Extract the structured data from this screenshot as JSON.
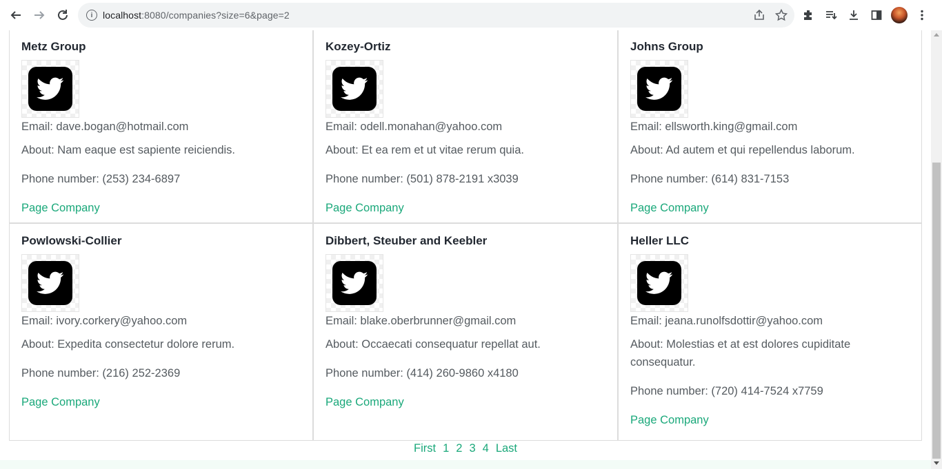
{
  "browser": {
    "url_host": "localhost",
    "url_rest": ":8080/companies?size=6&page=2"
  },
  "companies": [
    {
      "name": "Metz Group",
      "email": "Email: dave.bogan@hotmail.com",
      "about": "About: Nam eaque est sapiente reiciendis.",
      "phone": "Phone number: (253) 234-6897",
      "link": "Page Company"
    },
    {
      "name": "Kozey-Ortiz",
      "email": "Email: odell.monahan@yahoo.com",
      "about": "About: Et ea rem et ut vitae rerum quia.",
      "phone": "Phone number: (501) 878-2191 x3039",
      "link": "Page Company"
    },
    {
      "name": "Johns Group",
      "email": "Email: ellsworth.king@gmail.com",
      "about": "About: Ad autem et qui repellendus laborum.",
      "phone": "Phone number: (614) 831-7153",
      "link": "Page Company"
    },
    {
      "name": "Powlowski-Collier",
      "email": "Email: ivory.corkery@yahoo.com",
      "about": "About: Expedita consectetur dolore rerum.",
      "phone": "Phone number: (216) 252-2369",
      "link": "Page Company"
    },
    {
      "name": "Dibbert, Steuber and Keebler",
      "email": "Email: blake.oberbrunner@gmail.com",
      "about": "About: Occaecati consequatur repellat aut.",
      "phone": "Phone number: (414) 260-9860 x4180",
      "link": "Page Company"
    },
    {
      "name": "Heller LLC",
      "email": "Email: jeana.runolfsdottir@yahoo.com",
      "about": "About: Molestias et at est dolores cupiditate consequatur.",
      "phone": "Phone number: (720) 414-7524 x7759",
      "link": "Page Company"
    }
  ],
  "pagination": {
    "first": "First",
    "pages": [
      "1",
      "2",
      "3",
      "4"
    ],
    "last": "Last"
  },
  "colors": {
    "accent": "#1aa87a",
    "text": "#555b60",
    "heading": "#222831"
  },
  "icons": {
    "logo": "twitter-icon"
  }
}
